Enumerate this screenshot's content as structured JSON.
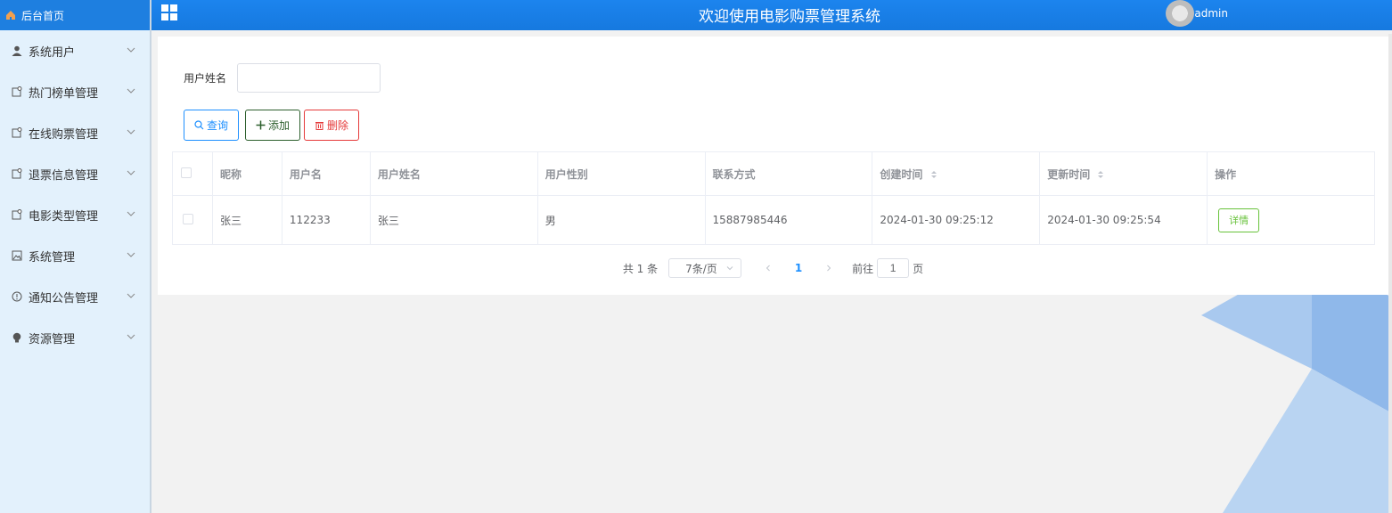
{
  "sidebar": {
    "home_label": "后台首页",
    "items": [
      {
        "label": "系统用户",
        "icon": "user-icon"
      },
      {
        "label": "热门榜单管理",
        "icon": "document-icon"
      },
      {
        "label": "在线购票管理",
        "icon": "document-icon"
      },
      {
        "label": "退票信息管理",
        "icon": "document-icon"
      },
      {
        "label": "电影类型管理",
        "icon": "document-icon"
      },
      {
        "label": "系统管理",
        "icon": "picture-icon"
      },
      {
        "label": "通知公告管理",
        "icon": "info-icon"
      },
      {
        "label": "资源管理",
        "icon": "bulb-icon"
      }
    ]
  },
  "header": {
    "title": "欢迎使用电影购票管理系统",
    "username": "admin"
  },
  "search": {
    "label": "用户姓名",
    "value": ""
  },
  "buttons": {
    "query": "查询",
    "add": "添加",
    "delete": "删除"
  },
  "table": {
    "columns": [
      "昵称",
      "用户名",
      "用户姓名",
      "用户性别",
      "联系方式",
      "创建时间",
      "更新时间",
      "操作"
    ],
    "rows": [
      {
        "nickname": "张三",
        "username": "112233",
        "realname": "张三",
        "gender": "男",
        "phone": "15887985446",
        "created": "2024-01-30 09:25:12",
        "updated": "2024-01-30 09:25:54",
        "action": "详情"
      }
    ]
  },
  "pagination": {
    "total": "共 1 条",
    "page_size": "7条/页",
    "current_page": "1",
    "goto_prefix": "前往",
    "goto_value": "1",
    "goto_suffix": "页"
  },
  "colors": {
    "accent": "#1e7fe0",
    "sidebar_bg": "#e3f1fc"
  }
}
